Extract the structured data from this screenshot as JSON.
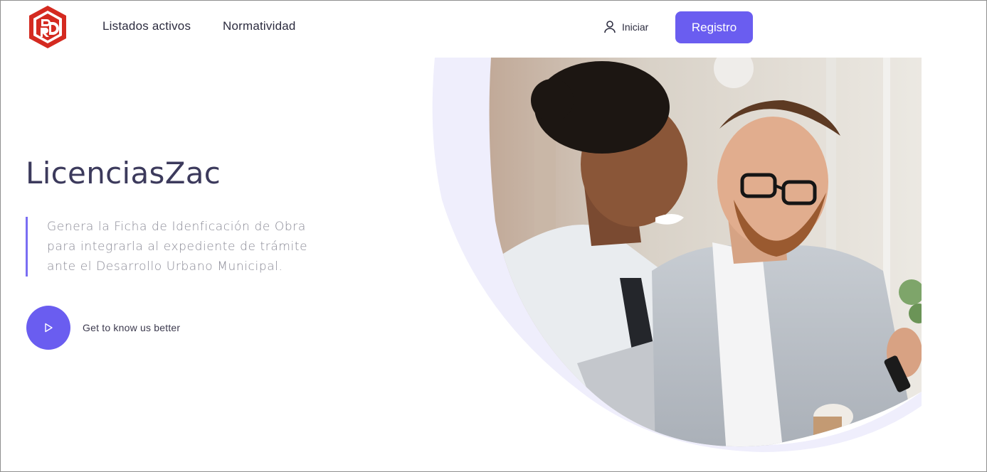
{
  "nav": {
    "links": [
      "Listados activos",
      "Normatividad"
    ],
    "login_label": "Iniciar",
    "register_label": "Registro",
    "logo_icon": "brand-logo-icon",
    "user_icon": "user-icon"
  },
  "hero": {
    "title": "LicenciasZac",
    "description": [
      "Genera la Ficha de Idenficación de Obra",
      "para integrarla al expediente de trámite",
      "ante el Desarrollo Urbano Municipal."
    ],
    "cta_label": "Get to know us better",
    "cta_icon": "play-icon"
  },
  "colors": {
    "accent": "#6a5df0",
    "title": "#3c3a5c",
    "logo_red": "#d42a20",
    "arc_tint": "#efeefc"
  }
}
